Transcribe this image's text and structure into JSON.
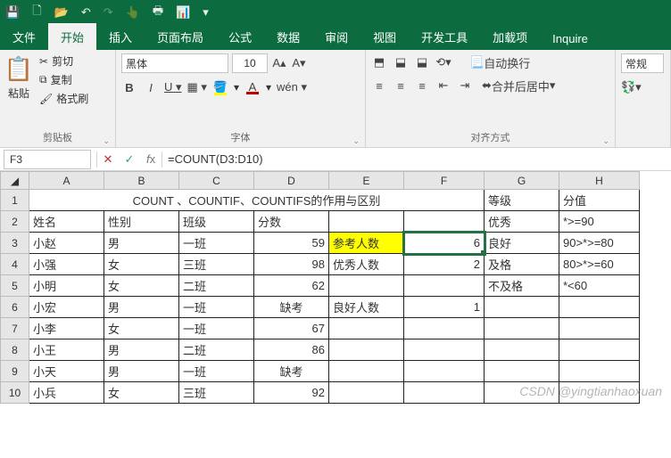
{
  "qat": {
    "save": "💾",
    "new": "🗋",
    "open": "📂",
    "undo": "↶",
    "redo": "↷",
    "touch": "👆",
    "print": "🖶",
    "chart": "📊",
    "add": "▾"
  },
  "tabs": {
    "file": "文件",
    "home": "开始",
    "insert": "插入",
    "layout": "页面布局",
    "formulas": "公式",
    "data": "数据",
    "review": "审阅",
    "view": "视图",
    "dev": "开发工具",
    "addins": "加载项",
    "inquire": "Inquire"
  },
  "ribbon": {
    "paste": "粘贴",
    "cut": "剪切",
    "copy": "复制",
    "formatpainter": "格式刷",
    "group_clipboard": "剪贴板",
    "font_name": "黑体",
    "font_size": "10",
    "group_font": "字体",
    "wrap": "自动换行",
    "merge": "合并后居中",
    "group_align": "对齐方式",
    "general": "常规"
  },
  "fbar": {
    "name": "F3",
    "formula": "=COUNT(D3:D10)"
  },
  "cols": [
    "A",
    "B",
    "C",
    "D",
    "E",
    "F",
    "G",
    "H"
  ],
  "rows": [
    "1",
    "2",
    "3",
    "4",
    "5",
    "6",
    "7",
    "8",
    "9",
    "10"
  ],
  "table": {
    "title": "COUNT 、COUNTIF、COUNTIFS的作用与区别",
    "hdr": {
      "a": "姓名",
      "b": "性别",
      "c": "班级",
      "d": "分数"
    },
    "r3": {
      "a": "小赵",
      "b": "男",
      "c": "一班",
      "d": "59",
      "e": "参考人数",
      "f": "6"
    },
    "r4": {
      "a": "小强",
      "b": "女",
      "c": "三班",
      "d": "98",
      "e": "优秀人数",
      "f": "2"
    },
    "r5": {
      "a": "小明",
      "b": "女",
      "c": "二班",
      "d": "62"
    },
    "r6": {
      "a": "小宏",
      "b": "男",
      "c": "一班",
      "d": "缺考",
      "e": "良好人数",
      "f": "1"
    },
    "r7": {
      "a": "小李",
      "b": "女",
      "c": "一班",
      "d": "67"
    },
    "r8": {
      "a": "小王",
      "b": "男",
      "c": "二班",
      "d": "86"
    },
    "r9": {
      "a": "小天",
      "b": "男",
      "c": "一班",
      "d": "缺考"
    },
    "r10": {
      "a": "小兵",
      "b": "女",
      "c": "三班",
      "d": "92"
    }
  },
  "side": {
    "g1": "等级",
    "h1": "分值",
    "g2": "优秀",
    "h2": "*>=90",
    "g3": "良好",
    "h3": "90>*>=80",
    "g4": "及格",
    "h4": "80>*>=60",
    "g5": "不及格",
    "h5": "*<60"
  },
  "watermark": "CSDN @yingtianhaoxuan"
}
